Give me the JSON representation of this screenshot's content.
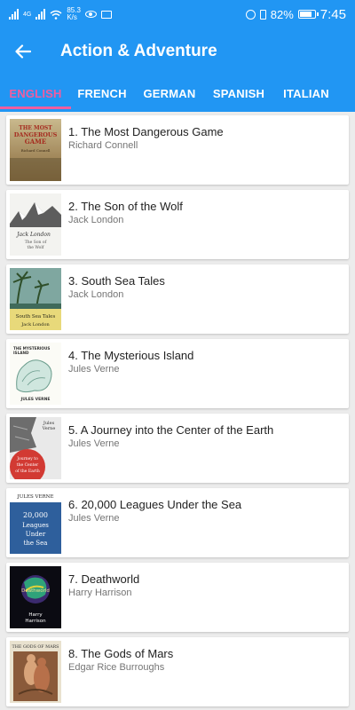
{
  "status_bar": {
    "network": "4G",
    "speed_value": "85.3",
    "speed_unit": "K/s",
    "battery": "82%",
    "time": "7:45"
  },
  "app_bar": {
    "title": "Action & Adventure"
  },
  "tabs": [
    {
      "label": "ENGLISH"
    },
    {
      "label": "FRENCH"
    },
    {
      "label": "GERMAN"
    },
    {
      "label": "SPANISH"
    },
    {
      "label": "ITALIAN"
    }
  ],
  "books": [
    {
      "title": "1. The Most Dangerous Game",
      "author": "Richard Connell",
      "cover_text": [
        "THE MOST",
        "DANGEROUS",
        "GAME",
        "Richard Connell"
      ]
    },
    {
      "title": "2. The Son of the Wolf",
      "author": "Jack London",
      "cover_text": [
        "Jack London",
        "The Son of",
        "the Wolf"
      ]
    },
    {
      "title": "3. South Sea Tales",
      "author": "Jack London",
      "cover_text": [
        "South Sea Tales",
        "Jack London"
      ]
    },
    {
      "title": "4. The Mysterious Island",
      "author": "Jules Verne",
      "cover_text": [
        "THE MYSTERIOUS",
        "ISLAND",
        "JULES VERNE"
      ]
    },
    {
      "title": "5. A Journey into the Center of the Earth",
      "author": "Jules Verne",
      "cover_text": [
        "Jules",
        "Verne",
        "Journey to",
        "the Center",
        "of the Earth"
      ]
    },
    {
      "title": "6. 20,000 Leagues Under the Sea",
      "author": "Jules Verne",
      "cover_text": [
        "JULES VERNE",
        "20,000",
        "Leagues",
        "Under",
        "the Sea"
      ]
    },
    {
      "title": "7. Deathworld",
      "author": "Harry Harrison",
      "cover_text": [
        "Deathworld",
        "Harry",
        "Harrison"
      ]
    },
    {
      "title": "8. The Gods of Mars",
      "author": "Edgar Rice Burroughs",
      "cover_text": [
        "THE GODS OF MARS"
      ]
    }
  ],
  "colors": {
    "primary": "#2196f3",
    "accent": "#f05da0",
    "background": "#ececec"
  },
  "icons": {
    "back": "arrow-left-icon"
  }
}
